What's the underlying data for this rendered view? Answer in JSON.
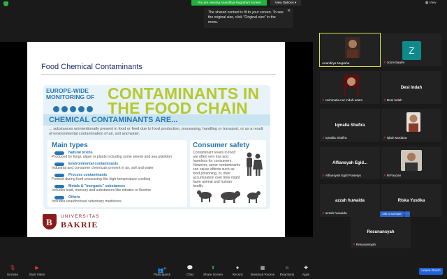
{
  "topbar": {
    "viewing_banner": "You are viewing Ananditya Nugraha's screen",
    "view_options": "View Options",
    "view_button": "View"
  },
  "tooltip": {
    "text": "The shared content is fit to your screen. To see the original size, click \"Original size\" in the menu."
  },
  "slide": {
    "title": "Food Chemical Contaminants",
    "europe_wide": "EUROPE-WIDE MONITORING OF",
    "big_title_line1": "CONTAMINANTS IN",
    "big_title_line2": "THE FOOD CHAIN",
    "are_header": "CHEMICAL CONTAMINANTS ARE...",
    "description": "... substances unintentionally present in food or feed due to food production, processing, handling or transport, or as a result of environmental contamination of air, soil and water.",
    "main_types_title": "Main types",
    "main_types": [
      {
        "head": "Natural toxins",
        "text": "Produced by fungi, algae or plants including some weeds and sea plankton"
      },
      {
        "head": "Environmental contaminants",
        "text": "Industrial and consumer chemicals present in air, soil and water"
      },
      {
        "head": "Process contaminants",
        "text": "Formed during food processing like high-temperature cooking"
      },
      {
        "head": "Metals & \"inorganic\" substances",
        "text": "Includes lead, mercury and substances like nitrates or fluorine"
      },
      {
        "head": "Others",
        "text": "Includes unauthorised veterinary medicines"
      }
    ],
    "consumer_title": "Consumer safety",
    "consumer_text": "Contaminant levels in food are often very low and harmless for consumers. However, some contaminants can cause effects such as food poisoning, or, their accumulation over time might harm animal and human health.",
    "logo_universitas": "UNIVERSITAS",
    "logo_bakrie": "BAKRIE",
    "logo_letter": "B"
  },
  "participants": [
    {
      "name": "Ananditya Nugraha",
      "center": "",
      "muted": false
    },
    {
      "name": "zoom baa04",
      "center": "",
      "avatar": "Z",
      "muted": true
    },
    {
      "name": "rachmatia nur indah adam",
      "center": "",
      "muted": true
    },
    {
      "name": "Desi Indah",
      "center": "Desi Indah",
      "muted": true
    },
    {
      "name": "Iqmalia Shafira",
      "center": "Iqmalia Shafira",
      "muted": true
    },
    {
      "name": "iqbal wardana",
      "center": "",
      "muted": true
    },
    {
      "name": "Alfiansyah Egid Prasetyo",
      "center": "Alfiansyah Egid...",
      "muted": true
    },
    {
      "name": "M Fauzan",
      "center": "",
      "muted": true
    },
    {
      "name": "azzah huwaida",
      "center": "azzah huwaida",
      "muted": true
    },
    {
      "name": "Riska Yustika",
      "center": "Riska Yustika",
      "muted": true
    },
    {
      "name": "Resunansyah",
      "center": "Resunansyah",
      "muted": true
    }
  ],
  "tile_actions": {
    "ask_unmute": "Ask to Unmute",
    "more": "..."
  },
  "toolbar": {
    "unmute": "Unmute",
    "start_video": "Start Video",
    "participants": "Participants",
    "participants_count": "11",
    "chat": "Chat",
    "share_screen": "Share Screen",
    "record": "Record",
    "breakout_rooms": "Breakout Rooms",
    "reactions": "Reactions",
    "apps": "Apps",
    "leave_room": "Leave Room"
  },
  "colors": {
    "accent_green": "#23b13c",
    "slide_blue": "#2876b0",
    "title_lime": "#b7c831",
    "leave_blue": "#2161d6",
    "active_outline": "#d6e64a",
    "muted_red": "#e03b3b"
  }
}
